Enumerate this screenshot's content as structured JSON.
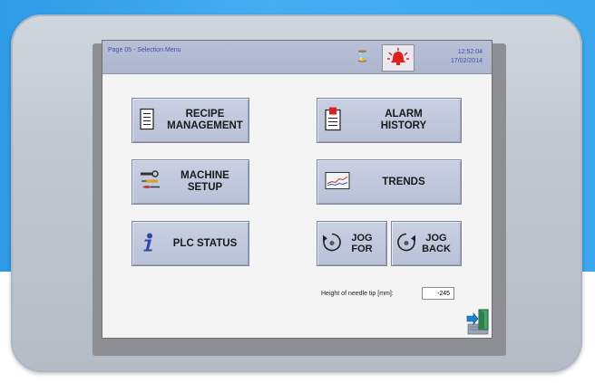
{
  "screen": {
    "page_title": "Page 05 - Selection Menu",
    "time": "12:52:04",
    "date": "17/02/2014"
  },
  "menu": {
    "recipe_management": [
      "RECIPE",
      "MANAGEMENT"
    ],
    "alarm_history": [
      "ALARM",
      "HISTORY"
    ],
    "machine_setup": [
      "MACHINE",
      "SETUP"
    ],
    "trends": "TRENDS",
    "plc_status": "PLC STATUS",
    "jog_for": [
      "JOG",
      "FOR"
    ],
    "jog_back": [
      "JOG",
      "BACK"
    ]
  },
  "needle": {
    "label": "Height of needle tip [mm]:",
    "value": "-245"
  },
  "icons": [
    "hourglass-icon",
    "alarm-bell-icon",
    "document-icon",
    "alarm-list-icon",
    "tools-icon",
    "trend-chart-icon",
    "info-icon",
    "rotate-forward-icon",
    "rotate-back-icon",
    "exit-door-icon"
  ],
  "colors": {
    "titlebar": "#b4bcd4",
    "button": "#c2c9de",
    "screen": "#f4f4f4",
    "accent_text": "#3d4ea6",
    "alarm_red": "#e02020"
  }
}
